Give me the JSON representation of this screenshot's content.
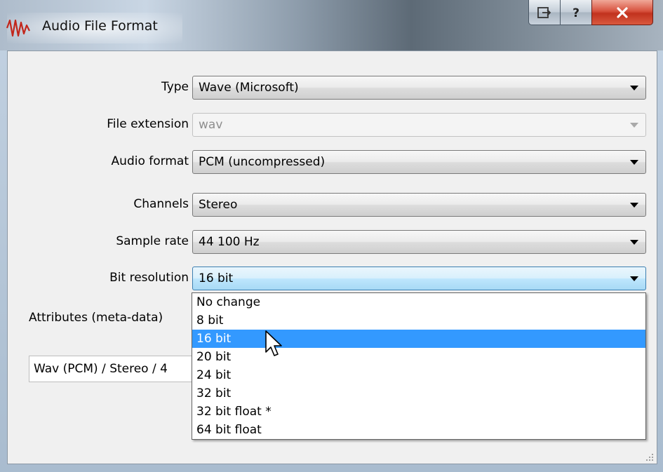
{
  "window": {
    "title": "Audio File Format"
  },
  "caption_buttons": {
    "restore": "restore-to-panel",
    "help": "?",
    "close": "X"
  },
  "fields": [
    {
      "label": "Type",
      "value": "Wave (Microsoft)",
      "disabled": false
    },
    {
      "label": "File extension",
      "value": "wav",
      "disabled": true
    },
    {
      "label": "Audio format",
      "value": "PCM (uncompressed)",
      "disabled": false
    },
    {
      "label": "Channels",
      "value": "Stereo",
      "disabled": false
    },
    {
      "label": "Sample rate",
      "value": "44 100 Hz",
      "disabled": false
    },
    {
      "label": "Bit resolution",
      "value": "16 bit",
      "disabled": false,
      "focused": true
    }
  ],
  "attributes": {
    "label": "Attributes (meta-data)"
  },
  "summary": {
    "text": "Wav (PCM) / Stereo / 4"
  },
  "bit_resolution_options": [
    "No change",
    "8 bit",
    "16 bit",
    "20 bit",
    "24 bit",
    "32 bit",
    "32 bit float *",
    "64 bit float"
  ],
  "selected_option_index": 2,
  "colors": {
    "selection": "#3399ff",
    "close_button": "#c1321e",
    "client_bg": "#f0f0f0"
  },
  "icons": [
    "waveform-app-icon",
    "restore-icon",
    "help-icon",
    "close-icon",
    "dropdown-arrow-icon",
    "mouse-pointer-icon",
    "resize-grip-icon"
  ]
}
